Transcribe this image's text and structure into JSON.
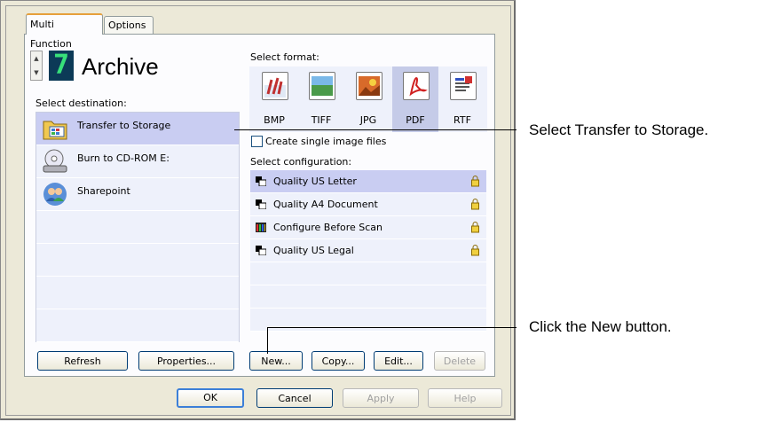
{
  "tabs": [
    "Multi Function",
    "Options"
  ],
  "profile": {
    "number": "7",
    "name": "Archive"
  },
  "destination": {
    "label": "Select destination:",
    "items": [
      "Transfer to Storage",
      "Burn to CD-ROM  E:",
      "Sharepoint"
    ],
    "selected": 0
  },
  "format": {
    "label": "Select format:",
    "items": [
      "BMP",
      "TIFF",
      "JPG",
      "PDF",
      "RTF"
    ],
    "selected": "PDF"
  },
  "single_image": {
    "label": "Create single image files",
    "checked": false
  },
  "configuration": {
    "label": "Select configuration:",
    "items": [
      "Quality US Letter",
      "Quality A4 Document",
      "Configure Before Scan",
      "Quality US Legal"
    ],
    "selected": 0
  },
  "buttons": {
    "refresh": "Refresh",
    "properties": "Properties...",
    "new": "New...",
    "copy": "Copy...",
    "edit": "Edit...",
    "delete": "Delete",
    "ok": "OK",
    "cancel": "Cancel",
    "apply": "Apply",
    "help": "Help"
  },
  "callouts": {
    "transfer": "Select Transfer to Storage.",
    "new": "Click the New button."
  }
}
